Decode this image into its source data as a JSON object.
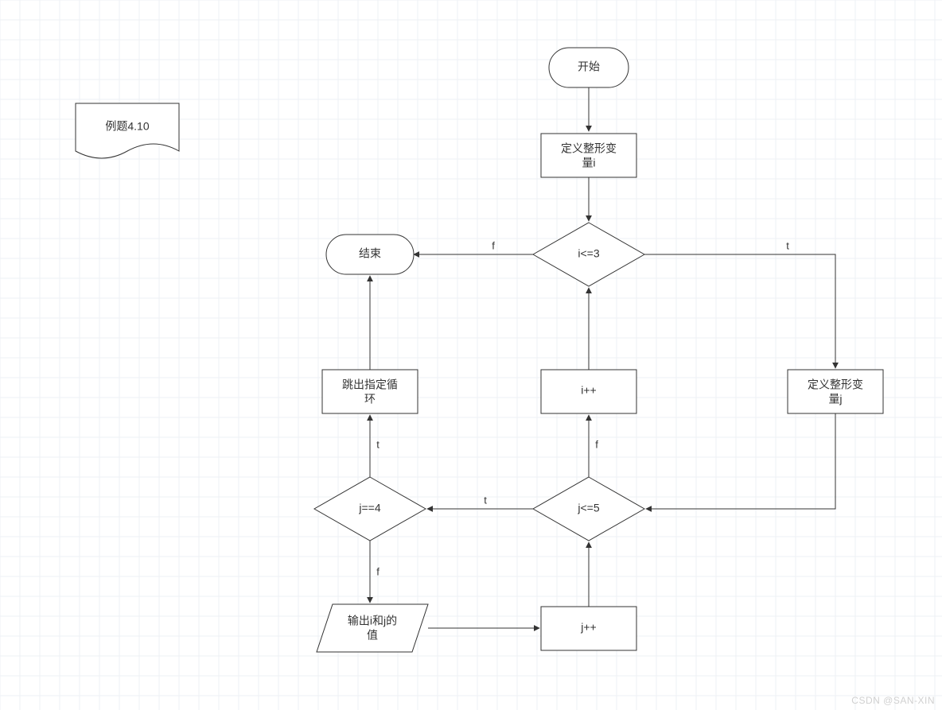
{
  "title_note": "例题4.10",
  "nodes": {
    "start": "开始",
    "define_i_l1": "定义整形变",
    "define_i_l2": "量i",
    "cond_i": "i<=3",
    "end": "结束",
    "define_j_l1": "定义整形变",
    "define_j_l2": "量j",
    "incr_i": "i++",
    "break_l1": "跳出指定循",
    "break_l2": "环",
    "cond_j5": "j<=5",
    "cond_j4": "j==4",
    "output_l1": "输出i和j的",
    "output_l2": "值",
    "incr_j": "j++"
  },
  "edges": {
    "f1": "f",
    "t1": "t",
    "f2": "f",
    "t2": "t",
    "t3": "t",
    "f3": "f"
  },
  "watermark": "CSDN @SAN-XIN"
}
